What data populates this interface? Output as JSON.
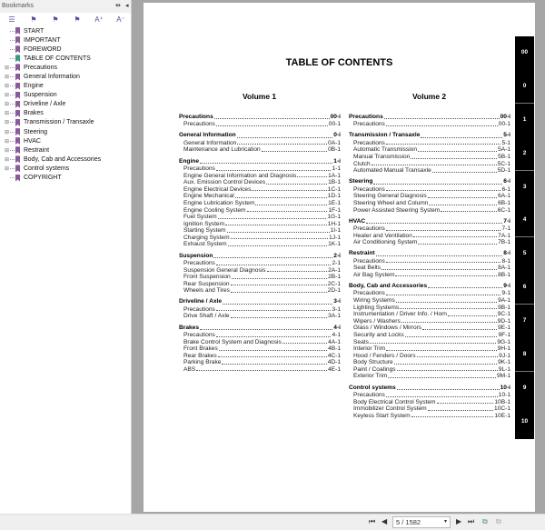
{
  "sidebar": {
    "title": "Bookmarks",
    "items": [
      {
        "label": "START",
        "expandable": false
      },
      {
        "label": "IMPORTANT",
        "expandable": false
      },
      {
        "label": "FOREWORD",
        "expandable": false
      },
      {
        "label": "TABLE OF CONTENTS",
        "expandable": false,
        "current": true
      },
      {
        "label": "Precautions",
        "expandable": true
      },
      {
        "label": "General Information",
        "expandable": true
      },
      {
        "label": "Engine",
        "expandable": true
      },
      {
        "label": "Suspension",
        "expandable": true
      },
      {
        "label": "Driveline / Axle",
        "expandable": true
      },
      {
        "label": "Brakes",
        "expandable": true
      },
      {
        "label": "Transmission / Transaxle",
        "expandable": true
      },
      {
        "label": "Steering",
        "expandable": true
      },
      {
        "label": "HVAC",
        "expandable": true
      },
      {
        "label": "Restraint",
        "expandable": true
      },
      {
        "label": "Body, Cab and Accessories",
        "expandable": true
      },
      {
        "label": "Control systems",
        "expandable": true
      },
      {
        "label": "COPYRIGHT",
        "expandable": false
      }
    ]
  },
  "page": {
    "title": "TABLE OF CONTENTS",
    "volumes": [
      {
        "label": "Volume 1",
        "sections": [
          {
            "title": "Precautions",
            "page": "00-i",
            "items": [
              [
                "Precautions",
                "00-1"
              ]
            ]
          },
          {
            "title": "General Information",
            "page": "0-i",
            "items": [
              [
                "General Information",
                "0A-1"
              ],
              [
                "Maintenance and Lubrication",
                "0B-1"
              ]
            ]
          },
          {
            "title": "Engine",
            "page": "1-i",
            "items": [
              [
                "Precautions",
                "1-1"
              ],
              [
                "Engine General Information and Diagnosis",
                "1A-1"
              ],
              [
                "Aux. Emission Control Devices",
                "1B-1"
              ],
              [
                "Engine Electrical Devices",
                "1C-1"
              ],
              [
                "Engine Mechanical",
                "1D-1"
              ],
              [
                "Engine Lubrication System",
                "1E-1"
              ],
              [
                "Engine Cooling System",
                "1F-1"
              ],
              [
                "Fuel System",
                "1G-1"
              ],
              [
                "Ignition System",
                "1H-1"
              ],
              [
                "Starting System",
                "1I-1"
              ],
              [
                "Charging System",
                "1J-1"
              ],
              [
                "Exhaust System",
                "1K-1"
              ]
            ]
          },
          {
            "title": "Suspension",
            "page": "2-i",
            "items": [
              [
                "Precautions",
                "2-1"
              ],
              [
                "Suspension General Diagnosis",
                "2A-1"
              ],
              [
                "Front Suspension",
                "2B-1"
              ],
              [
                "Rear Suspension",
                "2C-1"
              ],
              [
                "Wheels and Tires",
                "2D-1"
              ]
            ]
          },
          {
            "title": "Driveline / Axle",
            "page": "3-i",
            "items": [
              [
                "Precautions",
                "3-1"
              ],
              [
                "Drive Shaft / Axle",
                "3A-1"
              ]
            ]
          },
          {
            "title": "Brakes",
            "page": "4-i",
            "items": [
              [
                "Precautions",
                "4-1"
              ],
              [
                "Brake Control System and Diagnosis",
                "4A-1"
              ],
              [
                "Front Brakes",
                "4B-1"
              ],
              [
                "Rear Brakes",
                "4C-1"
              ],
              [
                "Parking Brake",
                "4D-1"
              ],
              [
                "ABS",
                "4E-1"
              ]
            ]
          }
        ]
      },
      {
        "label": "Volume 2",
        "sections": [
          {
            "title": "Precautions",
            "page": "00-i",
            "items": [
              [
                "Precautions",
                "00-1"
              ]
            ]
          },
          {
            "title": "Transmission / Transaxle",
            "page": "5-i",
            "items": [
              [
                "Precautions",
                "5-1"
              ],
              [
                "Automatic Transmission",
                "5A-1"
              ],
              [
                "Manual Transmission",
                "5B-1"
              ],
              [
                "Clutch",
                "5C-1"
              ],
              [
                "Automated Manual Transaxle",
                "5D-1"
              ]
            ]
          },
          {
            "title": "Steering",
            "page": "6-i",
            "items": [
              [
                "Precautions",
                "6-1"
              ],
              [
                "Steering General Diagnosis",
                "6A-1"
              ],
              [
                "Steering Wheel and Column",
                "6B-1"
              ],
              [
                "Power Assisted Steering System",
                "6C-1"
              ]
            ]
          },
          {
            "title": "HVAC",
            "page": "7-i",
            "items": [
              [
                "Precautions",
                "7-1"
              ],
              [
                "Heater and Ventilation",
                "7A-1"
              ],
              [
                "Air Conditioning System",
                "7B-1"
              ]
            ]
          },
          {
            "title": "Restraint",
            "page": "8-i",
            "items": [
              [
                "Precautions",
                "8-1"
              ],
              [
                "Seat Belts",
                "8A-1"
              ],
              [
                "Air Bag System",
                "8B-1"
              ]
            ]
          },
          {
            "title": "Body, Cab and Accessories",
            "page": "9-i",
            "items": [
              [
                "Precautions",
                "9-1"
              ],
              [
                "Wiring Systems",
                "9A-1"
              ],
              [
                "Lighting Systems",
                "9B-1"
              ],
              [
                "Instrumentation / Driver Info. / Horn",
                "9C-1"
              ],
              [
                "Wipers / Washers",
                "9D-1"
              ],
              [
                "Glass / Windows / Mirrors",
                "9E-1"
              ],
              [
                "Security and Locks",
                "9F-1"
              ],
              [
                "Seats",
                "9G-1"
              ],
              [
                "Interior Trim",
                "9H-1"
              ],
              [
                "Hood / Fenders / Doors",
                "9J-1"
              ],
              [
                "Body Structure",
                "9K-1"
              ],
              [
                "Paint / Coatings",
                "9L-1"
              ],
              [
                "Exterior Trim",
                "9M-1"
              ]
            ]
          },
          {
            "title": "Control systems",
            "page": "10-i",
            "items": [
              [
                "Precautions",
                "10-1"
              ],
              [
                "Body Electrical Control System",
                "10B-1"
              ],
              [
                "Immobilizer Control System",
                "10C-1"
              ],
              [
                "Keyless Start System",
                "10E-1"
              ]
            ]
          }
        ]
      }
    ],
    "tabs": [
      "00",
      "0",
      "1",
      "2",
      "3",
      "4",
      "5",
      "6",
      "7",
      "8",
      "9",
      "10"
    ]
  },
  "toolbar": {
    "page_indicator": "5 / 1582"
  }
}
